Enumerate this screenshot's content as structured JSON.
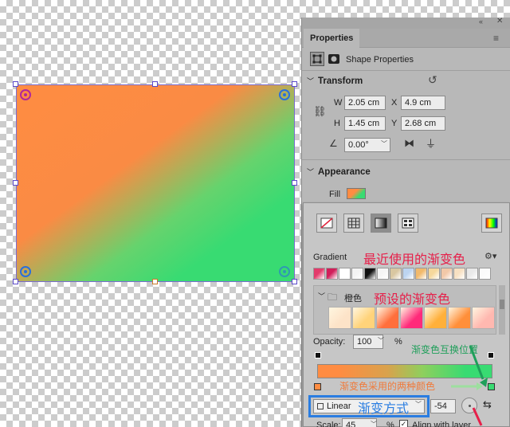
{
  "panel": {
    "tab_label": "Properties",
    "shape_properties_label": "Shape Properties",
    "transform": {
      "title": "Transform",
      "w_label": "W",
      "w_value": "2.05 cm",
      "x_label": "X",
      "x_value": "4.9 cm",
      "h_label": "H",
      "h_value": "1.45 cm",
      "y_label": "Y",
      "y_value": "2.68 cm",
      "angle_value": "0.00°"
    },
    "appearance": {
      "title": "Appearance",
      "fill_label": "Fill"
    }
  },
  "popover": {
    "gradient_label": "Gradient",
    "folder_label": "橙色",
    "opacity_label": "Opacity:",
    "opacity_value": "100",
    "opacity_unit": "%",
    "type_value": "Linear",
    "angle_value": "-54",
    "scale_label": "Scale:",
    "scale_value": "45",
    "scale_unit": "%",
    "align_label": "Align with layer",
    "recent_swatches": [
      "#e33a6b",
      "#d11f5a",
      "#ffffff",
      "#f3f3f3",
      "#111111",
      "#f5f5f5",
      "#d9c7a1",
      "#bcd4f0",
      "#f1b96b",
      "#f6d89c",
      "#f2c8a8",
      "#f7e0c2",
      "#e9e9e9",
      "#fbfbfb"
    ],
    "presets": [
      "#fde3c8",
      "#ffd37a",
      "#ff6f3c",
      "#ff2a7a",
      "#ffb03a",
      "#ff8f3a",
      "#ffb8b0"
    ],
    "stop_left_color": "#ff8c42",
    "stop_right_color": "#38db72"
  },
  "annotations": {
    "recent": "最近使用的渐变色",
    "presets": "预设的渐变色",
    "swap": "渐变色互换位置",
    "two_colors": "渐变色采用的两种颜色",
    "method": "渐变方式"
  }
}
